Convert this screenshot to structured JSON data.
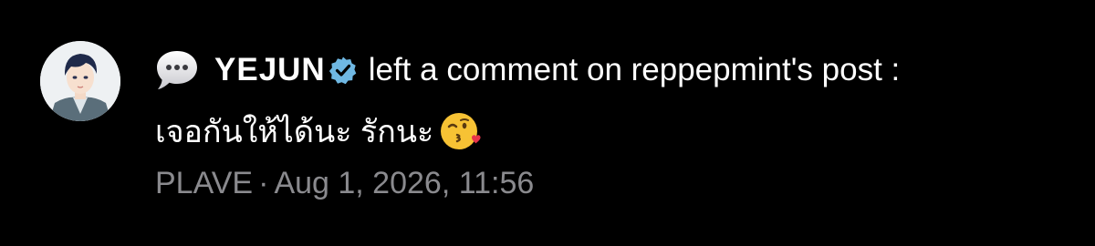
{
  "notification": {
    "icon": "speech-bubble-icon",
    "username": "YEJUN",
    "verified_icon": "verified-badge-icon",
    "action": "left a comment on reppepmint's post :",
    "comment": "เจอกันให้ได้นะ รักนะ",
    "emoji": "face-blowing-a-kiss-emoji",
    "source": "PLAVE",
    "separator": "·",
    "timestamp": "Aug 1, 2026, 11:56"
  },
  "colors": {
    "background": "#000000",
    "text_primary": "#ffffff",
    "text_secondary": "#8a8a8e",
    "verified_badge": "#6fb8e3"
  }
}
